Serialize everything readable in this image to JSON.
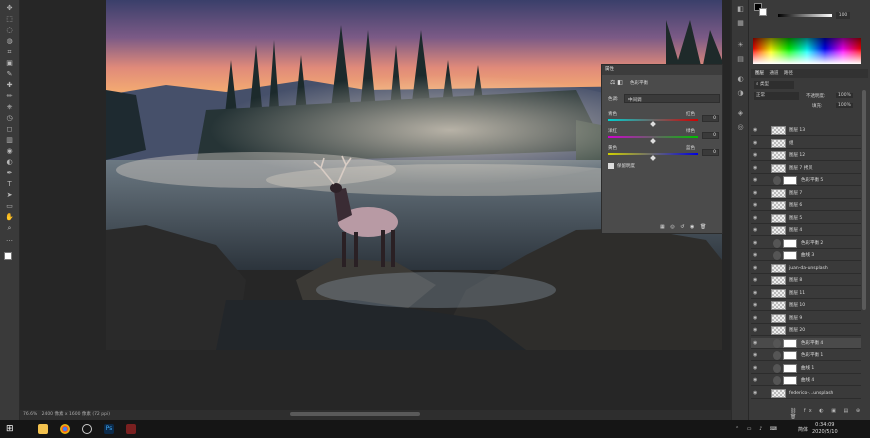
{
  "toolbar": {
    "tools": [
      "move-tool",
      "marquee-tool",
      "lasso-tool",
      "quick-select-tool",
      "crop-tool",
      "frame-tool",
      "eyedropper-tool",
      "healing-tool",
      "brush-tool",
      "stamp-tool",
      "history-brush-tool",
      "eraser-tool",
      "gradient-tool",
      "blur-tool",
      "dodge-tool",
      "pen-tool",
      "type-tool",
      "path-select-tool",
      "shape-tool",
      "hand-tool",
      "zoom-tool",
      "more-tools"
    ]
  },
  "status": {
    "zoom": "76.6%",
    "doc": "2400 像素 x 1600 像素 (72 ppi)"
  },
  "properties": {
    "tab_label": "属性",
    "title": "色彩平衡",
    "tone_label": "色调:",
    "tone_value": "中间调",
    "rows": [
      {
        "left": "青色",
        "right": "红色",
        "value": "0"
      },
      {
        "left": "洋红",
        "right": "绿色",
        "value": "0"
      },
      {
        "left": "黄色",
        "right": "蓝色",
        "value": "0"
      }
    ],
    "preserve_label": "保留明度"
  },
  "color_picker": {
    "slider_value": "100"
  },
  "layers": {
    "tabs": [
      "图层",
      "通道",
      "路径"
    ],
    "kind_label": "类型",
    "blend_mode": "正常",
    "opacity_label": "不透明度:",
    "opacity_value": "100%",
    "fill_label": "填充:",
    "fill_value": "100%",
    "items": [
      {
        "name": "图层 13",
        "type": "pixel"
      },
      {
        "name": "组",
        "type": "pixel"
      },
      {
        "name": "图层 12",
        "type": "pixel"
      },
      {
        "name": "图层 7 拷贝",
        "type": "pixel"
      },
      {
        "name": "色彩平衡 5",
        "type": "adj"
      },
      {
        "name": "图层 7",
        "type": "pixel"
      },
      {
        "name": "图层 6",
        "type": "pixel"
      },
      {
        "name": "图层 5",
        "type": "pixel"
      },
      {
        "name": "图层 4",
        "type": "pixel"
      },
      {
        "name": "色彩平衡 2",
        "type": "adj"
      },
      {
        "name": "曲线 3",
        "type": "adj"
      },
      {
        "name": "juan-da-unsplash",
        "type": "pixel"
      },
      {
        "name": "图层 8",
        "type": "pixel"
      },
      {
        "name": "图层 11",
        "type": "pixel"
      },
      {
        "name": "图层 10",
        "type": "pixel"
      },
      {
        "name": "图层 9",
        "type": "pixel"
      },
      {
        "name": "图层 20",
        "type": "pixel"
      },
      {
        "name": "色彩平衡 4",
        "type": "adj"
      },
      {
        "name": "色彩平衡 1",
        "type": "adj"
      },
      {
        "name": "曲线 1",
        "type": "adj"
      },
      {
        "name": "曲线 4",
        "type": "adj"
      },
      {
        "name": "federico-...unsplash",
        "type": "pixel"
      }
    ]
  },
  "taskbar": {
    "time": "0:34:09",
    "date": "2020/5/10",
    "lang": "简体"
  }
}
